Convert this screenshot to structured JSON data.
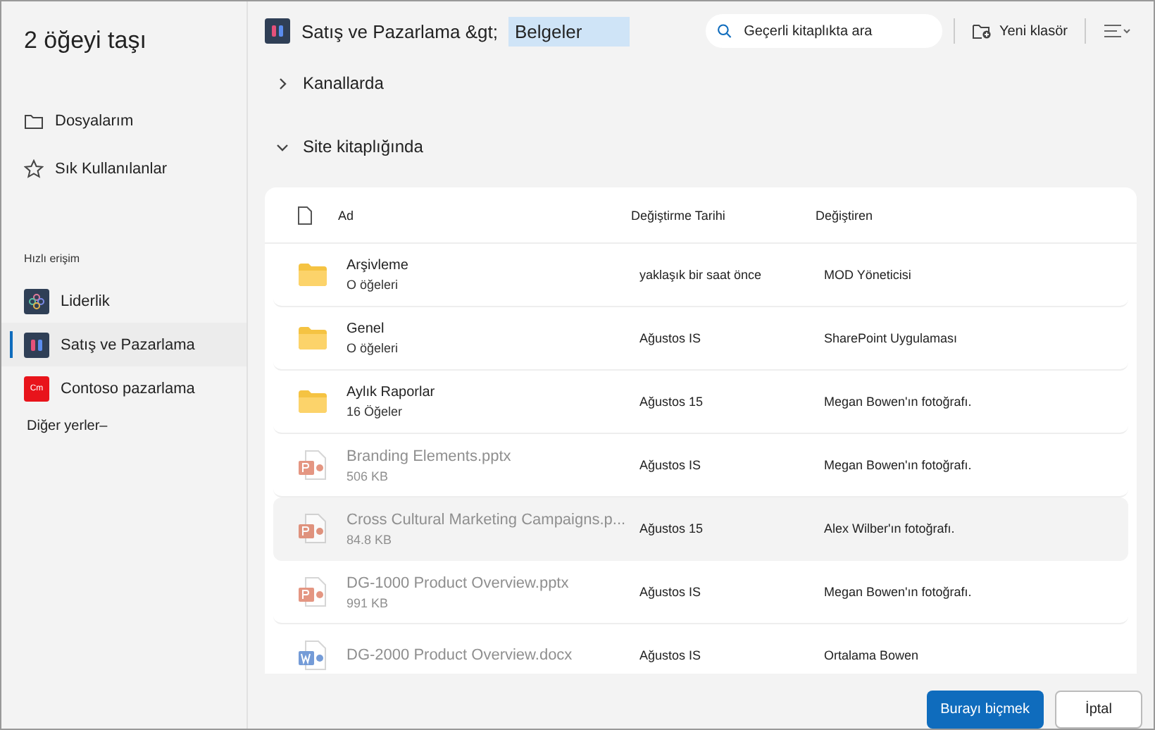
{
  "dialog": {
    "title": "2 öğeyi taşı"
  },
  "sidebar": {
    "items": [
      {
        "label": "Dosyalarım",
        "kind": "folder"
      },
      {
        "label": "Sık Kullanılanlar",
        "kind": "star"
      }
    ],
    "section_title": "Hızlı erişim",
    "sites": [
      {
        "label": "Liderlik",
        "kind": "grid",
        "selected": false
      },
      {
        "label": "Satış ve Pazarlama",
        "kind": "people",
        "selected": true
      },
      {
        "label": "Contoso pazarlama",
        "kind": "monogram",
        "monogram": "Cm",
        "selected": false
      }
    ],
    "more": "Diğer yerler–"
  },
  "breadcrumb": {
    "site": "Satış ve Pazarlama &gt;",
    "current": "Belgeler"
  },
  "search": {
    "placeholder": "Geçerli kitaplıkta ara"
  },
  "toolbar": {
    "new_folder": "Yeni klasör"
  },
  "groups": [
    {
      "label": "Kanallarda",
      "expanded": false
    },
    {
      "label": "Site kitaplığında",
      "expanded": true
    }
  ],
  "table": {
    "columns": [
      "Ad",
      "Değiştirme Tarihi",
      "Değiştiren"
    ],
    "rows": [
      {
        "kind": "folder",
        "name": "Arşivleme",
        "detail": "O öğeleri",
        "date": "yaklaşık bir saat önce",
        "by": "MOD Yöneticisi",
        "disabled": false,
        "selected": false
      },
      {
        "kind": "folder",
        "name": "Genel",
        "detail": "O öğeleri",
        "date": "Ağustos IS",
        "by": "SharePoint Uygulaması",
        "disabled": false,
        "selected": false
      },
      {
        "kind": "folder",
        "name": "Aylık Raporlar",
        "detail": "16 Öğeler",
        "date": "Ağustos 15",
        "by": "Megan Bowen'ın fotoğrafı.",
        "disabled": false,
        "selected": false
      },
      {
        "kind": "pptx",
        "name": "Branding Elements.pptx",
        "detail": "506 KB",
        "date": "Ağustos  IS",
        "by": "Megan Bowen'ın fotoğrafı.",
        "disabled": true,
        "selected": false
      },
      {
        "kind": "pptx",
        "name": "Cross Cultural Marketing Campaigns.p...",
        "detail": "84.8 KB",
        "date": "Ağustos 15",
        "by": "Alex Wilber'ın fotoğrafı.",
        "disabled": true,
        "selected": true
      },
      {
        "kind": "pptx",
        "name": "DG-1000 Product Overview.pptx",
        "detail": "991 KB",
        "date": "Ağustos IS",
        "by": "Megan Bowen'ın fotoğrafı.",
        "disabled": true,
        "selected": false
      },
      {
        "kind": "docx",
        "name": "DG-2000 Product Overview.docx",
        "date": "Ağustos IS",
        "by": "Ortalama Bowen",
        "disabled": true,
        "selected": false
      }
    ]
  },
  "buttons": {
    "primary": "Burayı biçmek",
    "secondary": "İptal"
  }
}
